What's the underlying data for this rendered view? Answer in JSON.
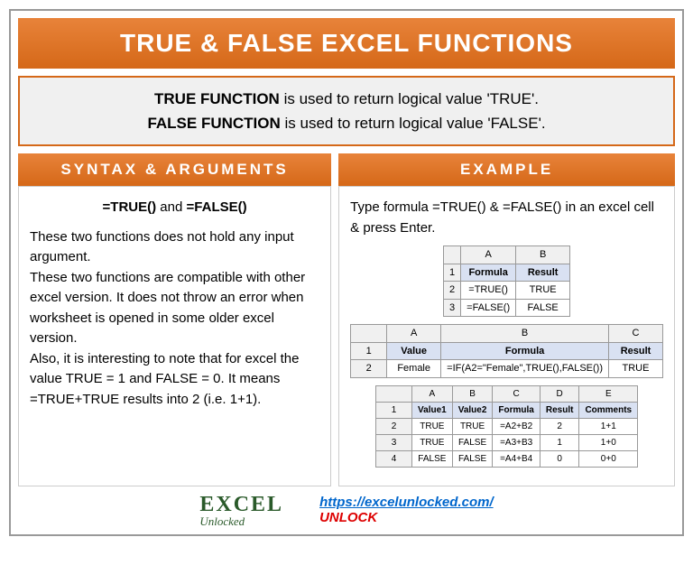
{
  "title": "TRUE & FALSE EXCEL FUNCTIONS",
  "intro": {
    "line1_bold": "TRUE FUNCTION",
    "line1_rest": " is used to return logical value 'TRUE'.",
    "line2_bold": "FALSE FUNCTION",
    "line2_rest": " is used to return logical value 'FALSE'."
  },
  "syntax": {
    "header": "SYNTAX & ARGUMENTS",
    "formula_true": "=TRUE()",
    "and": " and ",
    "formula_false": "=FALSE()",
    "para1": "These two functions does not hold any input argument.",
    "para2": "These two functions are compatible with other excel version. It does not throw an error when worksheet is opened in some older excel version.",
    "para3": "Also, it is interesting to note that for excel the value TRUE = 1 and FALSE = 0. It means =TRUE+TRUE results into 2 (i.e. 1+1)."
  },
  "example": {
    "header": "EXAMPLE",
    "intro": "Type formula =TRUE() & =FALSE() in an excel cell & press Enter.",
    "table1": {
      "cols": [
        "A",
        "B"
      ],
      "header_row": [
        "Formula",
        "Result"
      ],
      "rows": [
        [
          "=TRUE()",
          "TRUE"
        ],
        [
          "=FALSE()",
          "FALSE"
        ]
      ]
    },
    "table2": {
      "cols": [
        "A",
        "B",
        "C"
      ],
      "header_row": [
        "Value",
        "Formula",
        "Result"
      ],
      "rows": [
        [
          "Female",
          "=IF(A2=\"Female\",TRUE(),FALSE())",
          "TRUE"
        ]
      ]
    },
    "table3": {
      "cols": [
        "A",
        "B",
        "C",
        "D",
        "E"
      ],
      "header_row": [
        "Value1",
        "Value2",
        "Formula",
        "Result",
        "Comments"
      ],
      "rows": [
        [
          "TRUE",
          "TRUE",
          "=A2+B2",
          "2",
          "1+1"
        ],
        [
          "TRUE",
          "FALSE",
          "=A3+B3",
          "1",
          "1+0"
        ],
        [
          "FALSE",
          "FALSE",
          "=A4+B4",
          "0",
          "0+0"
        ]
      ]
    }
  },
  "footer": {
    "logo_top": "EXCEL",
    "logo_bottom": "Unlocked",
    "url": "https://excelunlocked.com/",
    "unlock": "UNLOCK"
  }
}
